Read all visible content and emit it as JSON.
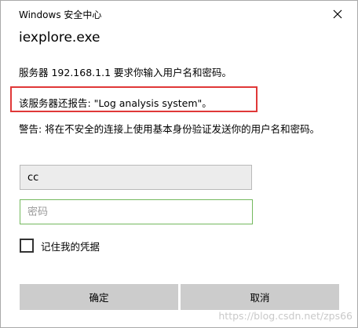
{
  "window": {
    "title": "Windows 安全中心",
    "app_name": "iexplore.exe"
  },
  "messages": {
    "server_request": "服务器 192.168.1.1 要求你输入用户名和密码。",
    "server_report": "该服务器还报告: \"Log analysis system\"。",
    "warning": "警告: 将在不安全的连接上使用基本身份验证发送你的用户名和密码。"
  },
  "form": {
    "username_value": "cc",
    "password_placeholder": "密码",
    "remember_label": "记住我的凭据",
    "remember_checked": false
  },
  "buttons": {
    "ok_label": "确定",
    "cancel_label": "取消"
  },
  "watermark": "https://blog.csdn.net/zps66",
  "colors": {
    "highlight_border": "#e03838",
    "focused_field_border": "#74b95e",
    "button_background": "#cccccc"
  },
  "icons": {
    "close": "close-icon"
  }
}
